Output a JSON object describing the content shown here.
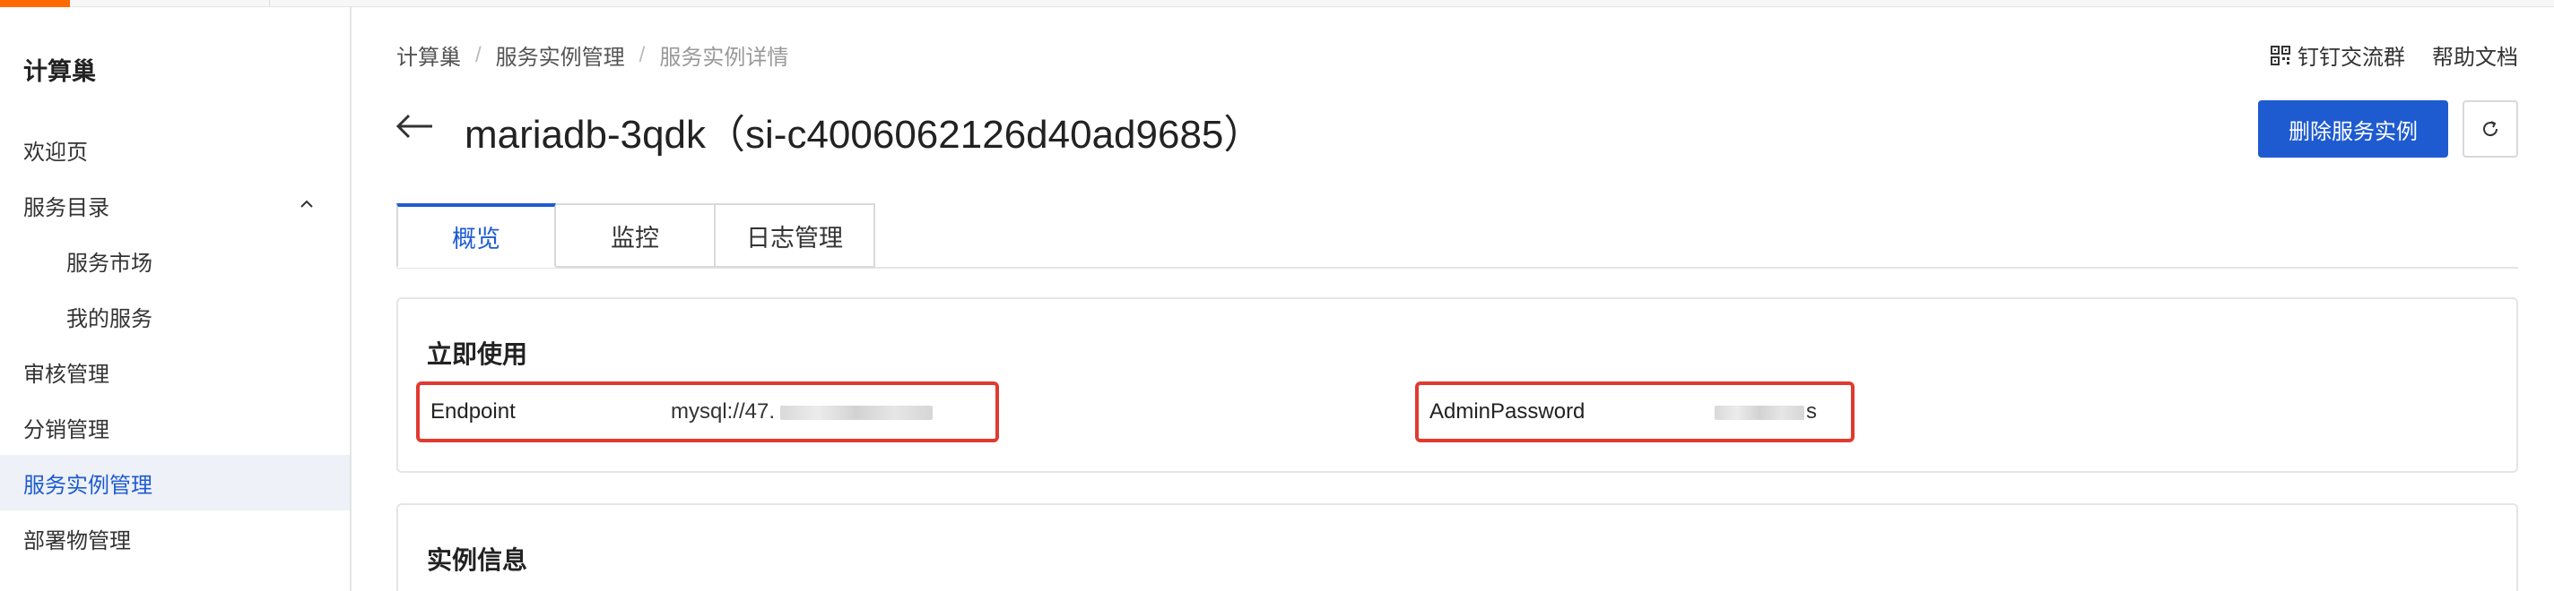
{
  "sidebar": {
    "app_title": "计算巢",
    "items": [
      {
        "label": "欢迎页"
      },
      {
        "label": "服务目录"
      },
      {
        "label": "服务市场"
      },
      {
        "label": "我的服务"
      },
      {
        "label": "审核管理"
      },
      {
        "label": "分销管理"
      },
      {
        "label": "服务实例管理"
      },
      {
        "label": "部署物管理"
      }
    ],
    "active_index": 6
  },
  "breadcrumb": [
    "计算巢",
    "服务实例管理",
    "服务实例详情"
  ],
  "header_links": {
    "dingtalk": "钉钉交流群",
    "help": "帮助文档"
  },
  "page": {
    "title": "mariadb-3qdk（si-c4006062126d40ad9685）",
    "delete_button": "删除服务实例"
  },
  "tabs": [
    {
      "label": "概览"
    },
    {
      "label": "监控"
    },
    {
      "label": "日志管理"
    }
  ],
  "active_tab": 0,
  "quick_use": {
    "title": "立即使用",
    "endpoint_label": "Endpoint",
    "endpoint_value": "mysql://47.",
    "password_label": "AdminPassword",
    "password_value": "s"
  },
  "instance_info": {
    "title": "实例信息"
  },
  "colors": {
    "primary": "#1e5bd1",
    "highlight_border": "#e03a2f",
    "brand_accent": "#ff6a00"
  }
}
